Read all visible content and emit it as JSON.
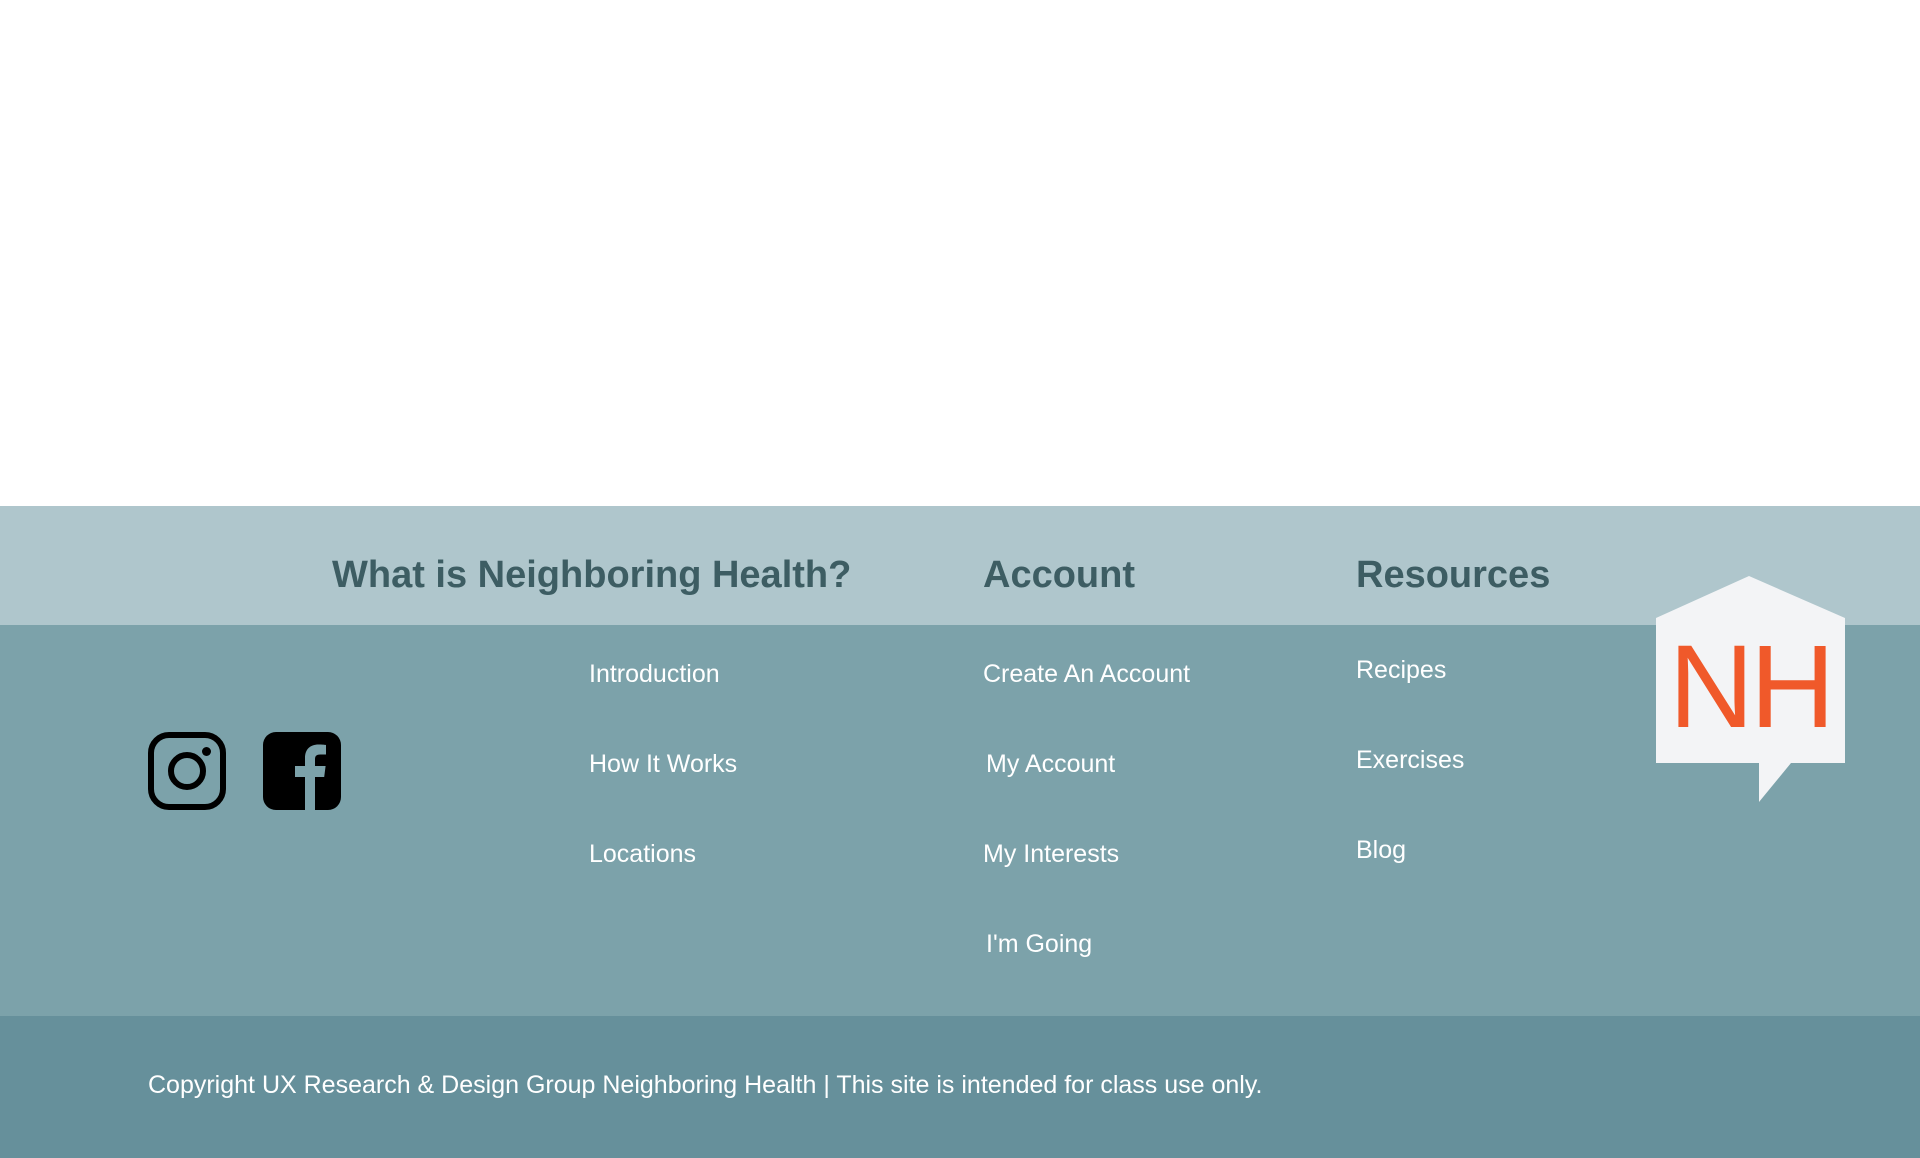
{
  "footer": {
    "columns": {
      "about": {
        "heading": "What is Neighboring Health?",
        "links": [
          {
            "label": "Introduction"
          },
          {
            "label": "How It Works"
          },
          {
            "label": "Locations"
          }
        ]
      },
      "account": {
        "heading": "Account",
        "links": [
          {
            "label": "Create An Account"
          },
          {
            "label": "My Account"
          },
          {
            "label": "My Interests"
          },
          {
            "label": "I'm Going"
          }
        ]
      },
      "resources": {
        "heading": "Resources",
        "links": [
          {
            "label": "Recipes"
          },
          {
            "label": "Exercises"
          },
          {
            "label": "Blog"
          }
        ]
      }
    },
    "social": [
      {
        "icon": "instagram-icon"
      },
      {
        "icon": "facebook-icon"
      }
    ],
    "logo": {
      "text": "NH",
      "text_color": "#f0592a",
      "shape_color": "#f3f4f6"
    },
    "copyright": "Copyright UX Research & Design Group Neighboring Health | This site is intended for class use only."
  },
  "colors": {
    "page_background": "#ffffff",
    "heading_band": "#afc6cc",
    "links_band": "#7ca2aa",
    "copyright_band": "#66909b",
    "heading_text": "#3d5d63",
    "link_text": "#ffffff"
  }
}
